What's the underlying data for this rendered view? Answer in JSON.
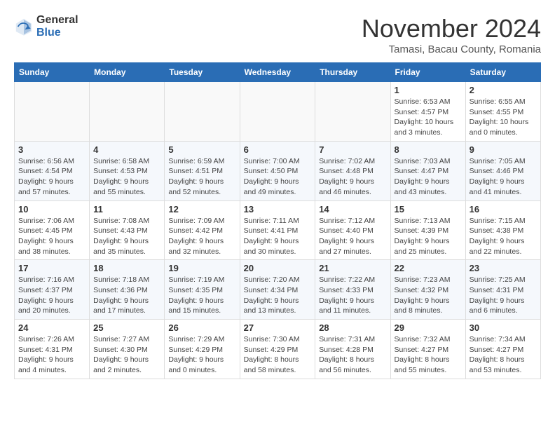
{
  "header": {
    "logo_general": "General",
    "logo_blue": "Blue",
    "month_title": "November 2024",
    "subtitle": "Tamasi, Bacau County, Romania"
  },
  "days_of_week": [
    "Sunday",
    "Monday",
    "Tuesday",
    "Wednesday",
    "Thursday",
    "Friday",
    "Saturday"
  ],
  "weeks": [
    [
      {
        "day": "",
        "info": ""
      },
      {
        "day": "",
        "info": ""
      },
      {
        "day": "",
        "info": ""
      },
      {
        "day": "",
        "info": ""
      },
      {
        "day": "",
        "info": ""
      },
      {
        "day": "1",
        "info": "Sunrise: 6:53 AM\nSunset: 4:57 PM\nDaylight: 10 hours and 3 minutes."
      },
      {
        "day": "2",
        "info": "Sunrise: 6:55 AM\nSunset: 4:55 PM\nDaylight: 10 hours and 0 minutes."
      }
    ],
    [
      {
        "day": "3",
        "info": "Sunrise: 6:56 AM\nSunset: 4:54 PM\nDaylight: 9 hours and 57 minutes."
      },
      {
        "day": "4",
        "info": "Sunrise: 6:58 AM\nSunset: 4:53 PM\nDaylight: 9 hours and 55 minutes."
      },
      {
        "day": "5",
        "info": "Sunrise: 6:59 AM\nSunset: 4:51 PM\nDaylight: 9 hours and 52 minutes."
      },
      {
        "day": "6",
        "info": "Sunrise: 7:00 AM\nSunset: 4:50 PM\nDaylight: 9 hours and 49 minutes."
      },
      {
        "day": "7",
        "info": "Sunrise: 7:02 AM\nSunset: 4:48 PM\nDaylight: 9 hours and 46 minutes."
      },
      {
        "day": "8",
        "info": "Sunrise: 7:03 AM\nSunset: 4:47 PM\nDaylight: 9 hours and 43 minutes."
      },
      {
        "day": "9",
        "info": "Sunrise: 7:05 AM\nSunset: 4:46 PM\nDaylight: 9 hours and 41 minutes."
      }
    ],
    [
      {
        "day": "10",
        "info": "Sunrise: 7:06 AM\nSunset: 4:45 PM\nDaylight: 9 hours and 38 minutes."
      },
      {
        "day": "11",
        "info": "Sunrise: 7:08 AM\nSunset: 4:43 PM\nDaylight: 9 hours and 35 minutes."
      },
      {
        "day": "12",
        "info": "Sunrise: 7:09 AM\nSunset: 4:42 PM\nDaylight: 9 hours and 32 minutes."
      },
      {
        "day": "13",
        "info": "Sunrise: 7:11 AM\nSunset: 4:41 PM\nDaylight: 9 hours and 30 minutes."
      },
      {
        "day": "14",
        "info": "Sunrise: 7:12 AM\nSunset: 4:40 PM\nDaylight: 9 hours and 27 minutes."
      },
      {
        "day": "15",
        "info": "Sunrise: 7:13 AM\nSunset: 4:39 PM\nDaylight: 9 hours and 25 minutes."
      },
      {
        "day": "16",
        "info": "Sunrise: 7:15 AM\nSunset: 4:38 PM\nDaylight: 9 hours and 22 minutes."
      }
    ],
    [
      {
        "day": "17",
        "info": "Sunrise: 7:16 AM\nSunset: 4:37 PM\nDaylight: 9 hours and 20 minutes."
      },
      {
        "day": "18",
        "info": "Sunrise: 7:18 AM\nSunset: 4:36 PM\nDaylight: 9 hours and 17 minutes."
      },
      {
        "day": "19",
        "info": "Sunrise: 7:19 AM\nSunset: 4:35 PM\nDaylight: 9 hours and 15 minutes."
      },
      {
        "day": "20",
        "info": "Sunrise: 7:20 AM\nSunset: 4:34 PM\nDaylight: 9 hours and 13 minutes."
      },
      {
        "day": "21",
        "info": "Sunrise: 7:22 AM\nSunset: 4:33 PM\nDaylight: 9 hours and 11 minutes."
      },
      {
        "day": "22",
        "info": "Sunrise: 7:23 AM\nSunset: 4:32 PM\nDaylight: 9 hours and 8 minutes."
      },
      {
        "day": "23",
        "info": "Sunrise: 7:25 AM\nSunset: 4:31 PM\nDaylight: 9 hours and 6 minutes."
      }
    ],
    [
      {
        "day": "24",
        "info": "Sunrise: 7:26 AM\nSunset: 4:31 PM\nDaylight: 9 hours and 4 minutes."
      },
      {
        "day": "25",
        "info": "Sunrise: 7:27 AM\nSunset: 4:30 PM\nDaylight: 9 hours and 2 minutes."
      },
      {
        "day": "26",
        "info": "Sunrise: 7:29 AM\nSunset: 4:29 PM\nDaylight: 9 hours and 0 minutes."
      },
      {
        "day": "27",
        "info": "Sunrise: 7:30 AM\nSunset: 4:29 PM\nDaylight: 8 hours and 58 minutes."
      },
      {
        "day": "28",
        "info": "Sunrise: 7:31 AM\nSunset: 4:28 PM\nDaylight: 8 hours and 56 minutes."
      },
      {
        "day": "29",
        "info": "Sunrise: 7:32 AM\nSunset: 4:27 PM\nDaylight: 8 hours and 55 minutes."
      },
      {
        "day": "30",
        "info": "Sunrise: 7:34 AM\nSunset: 4:27 PM\nDaylight: 8 hours and 53 minutes."
      }
    ]
  ]
}
